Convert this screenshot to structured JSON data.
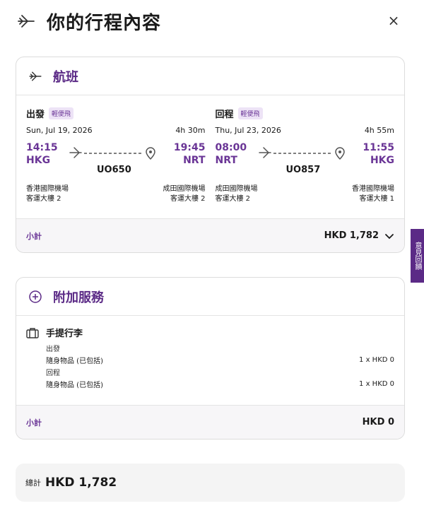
{
  "header": {
    "title": "你的行程內容",
    "close_label": "×"
  },
  "flight": {
    "section_label": "航班",
    "legs": [
      {
        "title": "出發",
        "badge": "輕便飛",
        "date": "Sun, Jul 19, 2026",
        "duration": "4h 30m",
        "dep_time": "14:15",
        "arr_time": "19:45",
        "dep_code": "HKG",
        "arr_code": "NRT",
        "flight_no": "UO650",
        "dep_airport": "香港國際機場",
        "dep_terminal": "客運大樓 2",
        "arr_airport": "成田國際機場",
        "arr_terminal": "客運大樓 2"
      },
      {
        "title": "回程",
        "badge": "輕便飛",
        "date": "Thu, Jul 23, 2026",
        "duration": "4h 55m",
        "dep_time": "08:00",
        "arr_time": "11:55",
        "dep_code": "NRT",
        "arr_code": "HKG",
        "flight_no": "UO857",
        "dep_airport": "成田國際機場",
        "dep_terminal": "客運大樓 2",
        "arr_airport": "香港國際機場",
        "arr_terminal": "客運大樓 1"
      }
    ],
    "subtotal_label": "小計",
    "subtotal_amount": "HKD 1,782"
  },
  "addons": {
    "section_label": "附加服務",
    "item_title": "手提行李",
    "rows": [
      {
        "label": "出發",
        "value": ""
      },
      {
        "label": "隨身物品 (已包括)",
        "value": "1 x HKD 0"
      },
      {
        "label": "回程",
        "value": ""
      },
      {
        "label": "隨身物品 (已包括)",
        "value": "1 x HKD 0"
      }
    ],
    "subtotal_label": "小計",
    "subtotal_amount": "HKD 0"
  },
  "total": {
    "label": "總計",
    "amount": "HKD 1,782"
  },
  "side_tab": {
    "label": "意見回饋"
  },
  "colors": {
    "accent": "#6a3596",
    "brand": "#5b2a86"
  }
}
